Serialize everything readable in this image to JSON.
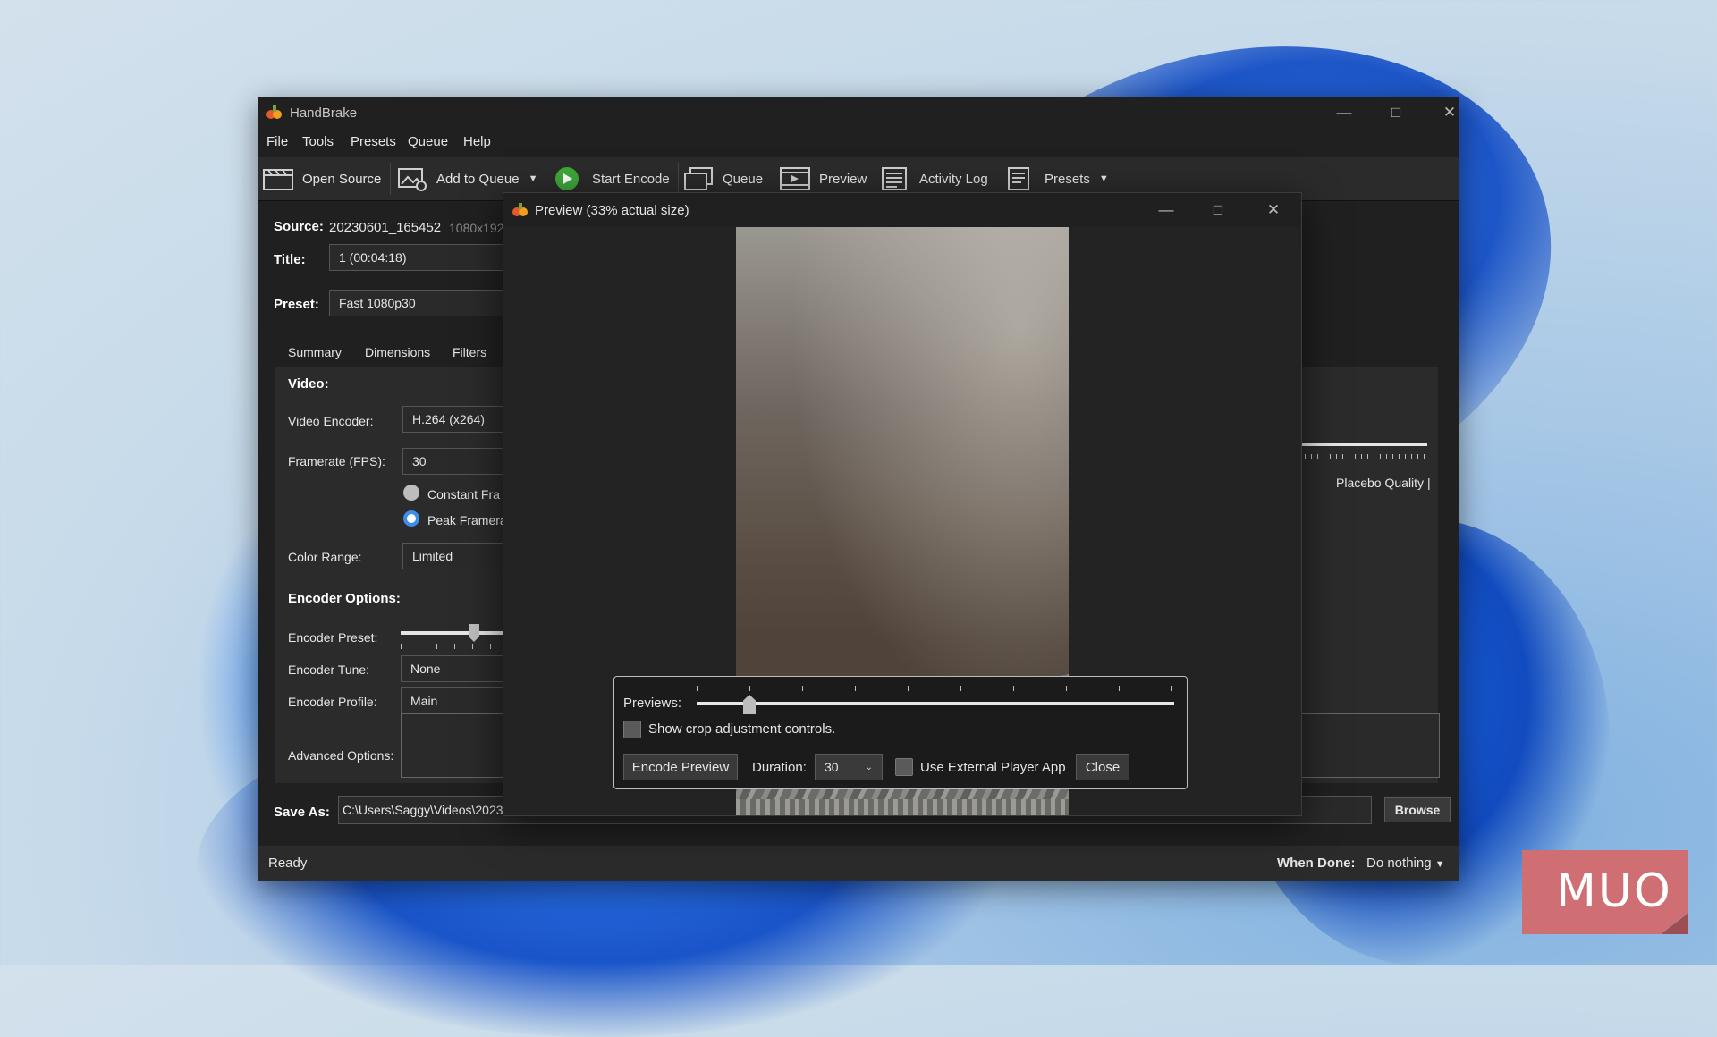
{
  "app": {
    "title": "HandBrake",
    "menu": [
      "File",
      "Tools",
      "Presets",
      "Queue",
      "Help"
    ],
    "toolbar": {
      "open_source": "Open Source",
      "add_to_queue": "Add to Queue",
      "start_encode": "Start Encode",
      "queue": "Queue",
      "preview": "Preview",
      "activity_log": "Activity Log",
      "presets": "Presets"
    },
    "source_label": "Source:",
    "source_value": "20230601_165452",
    "source_extra": "1080x192",
    "title_label": "Title:",
    "title_value": "1  (00:04:18)",
    "preset_label": "Preset:",
    "preset_value": "Fast 1080p30",
    "tabs": [
      "Summary",
      "Dimensions",
      "Filters"
    ],
    "video_heading": "Video:",
    "video_encoder_label": "Video Encoder:",
    "video_encoder_value": "H.264 (x264)",
    "framerate_label": "Framerate (FPS):",
    "framerate_value": "30",
    "constant_framerate": "Constant Fra",
    "peak_framerate": "Peak Framera",
    "color_range_label": "Color Range:",
    "color_range_value": "Limited",
    "encoder_options_heading": "Encoder Options:",
    "encoder_preset_label": "Encoder Preset:",
    "encoder_tune_label": "Encoder Tune:",
    "encoder_tune_value": "None",
    "encoder_profile_label": "Encoder Profile:",
    "encoder_profile_value": "Main",
    "advanced_options_label": "Advanced Options:",
    "quality_label": "Placebo Quality |",
    "save_as_label": "Save As:",
    "save_as_value": "C:\\Users\\Saggy\\Videos\\2023",
    "browse": "Browse",
    "status": "Ready",
    "when_done_label": "When Done:",
    "when_done_value": "Do nothing"
  },
  "preview_dialog": {
    "title": "Preview (33% actual size)",
    "previews_label": "Previews:",
    "show_crop": "Show crop adjustment controls.",
    "encode_preview": "Encode Preview",
    "duration_label": "Duration:",
    "duration_value": "30",
    "use_external": "Use External Player App",
    "close": "Close"
  },
  "watermark": "MUO"
}
